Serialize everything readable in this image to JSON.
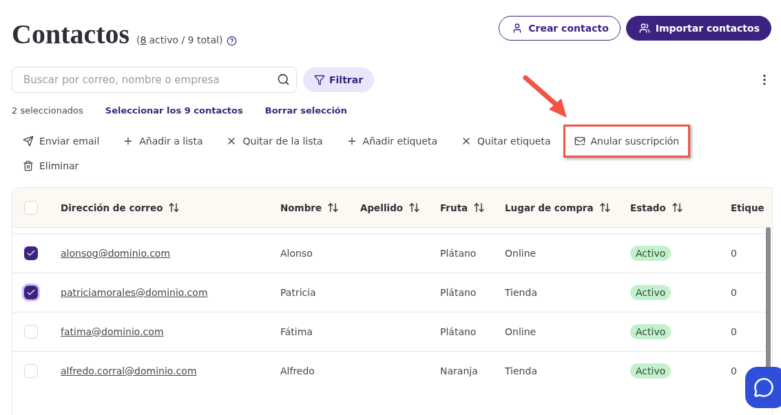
{
  "header": {
    "title": "Contactos",
    "count": {
      "prefix": "(",
      "active": "8",
      "suffix": "activo / 9 total)"
    },
    "buttons": [
      {
        "label": "Crear contacto",
        "kind": "outline"
      },
      {
        "label": "Importar contactos",
        "kind": "primary"
      }
    ]
  },
  "search": {
    "placeholder": "Buscar por correo, nombre o empresa"
  },
  "filter": {
    "label": "Filtrar"
  },
  "selection": {
    "summary": "2 seleccionados",
    "links": [
      "Seleccionar los 9 contactos",
      "Borrar selección"
    ]
  },
  "actions": [
    {
      "label": "Enviar email",
      "kind": "send",
      "highlighted": false
    },
    {
      "label": "Añadir a lista",
      "kind": "add",
      "highlighted": false
    },
    {
      "label": "Quitar de la lista",
      "kind": "remove",
      "highlighted": false
    },
    {
      "label": "Añadir etiqueta",
      "kind": "add",
      "highlighted": false
    },
    {
      "label": "Quitar etiqueta",
      "kind": "remove",
      "highlighted": false
    },
    {
      "label": "Anular suscripción",
      "kind": "unsubscribe",
      "highlighted": true
    },
    {
      "label": "Eliminar",
      "kind": "delete",
      "highlighted": false
    }
  ],
  "table": {
    "select_all": {
      "checked": false
    },
    "columns": [
      {
        "label": "Dirección de correo"
      },
      {
        "label": "Nombre"
      },
      {
        "label": "Apellido"
      },
      {
        "label": "Fruta"
      },
      {
        "label": "Lugar de compra"
      },
      {
        "label": "Estado"
      },
      {
        "label": "Etique"
      }
    ],
    "rows": [
      {
        "checked": true,
        "focused": false,
        "email": "alonsog@dominio.com",
        "name": "Alonso",
        "surname": "",
        "fruit": "Plátano",
        "place": "Online",
        "status": "Activo",
        "tags": "0"
      },
      {
        "checked": true,
        "focused": true,
        "email": "patriciamorales@dominio.com",
        "name": "Patricia",
        "surname": "",
        "fruit": "Plátano",
        "place": "Tienda",
        "status": "Activo",
        "tags": "0"
      },
      {
        "checked": false,
        "focused": false,
        "email": "fatima@dominio.com",
        "name": "Fátima",
        "surname": "",
        "fruit": "Plátano",
        "place": "Online",
        "status": "Activo",
        "tags": "0"
      },
      {
        "checked": false,
        "focused": false,
        "email": "alfredo.corral@dominio.com",
        "name": "Alfredo",
        "surname": "",
        "fruit": "Naranja",
        "place": "Tienda",
        "status": "Activo",
        "tags": "0"
      }
    ]
  }
}
